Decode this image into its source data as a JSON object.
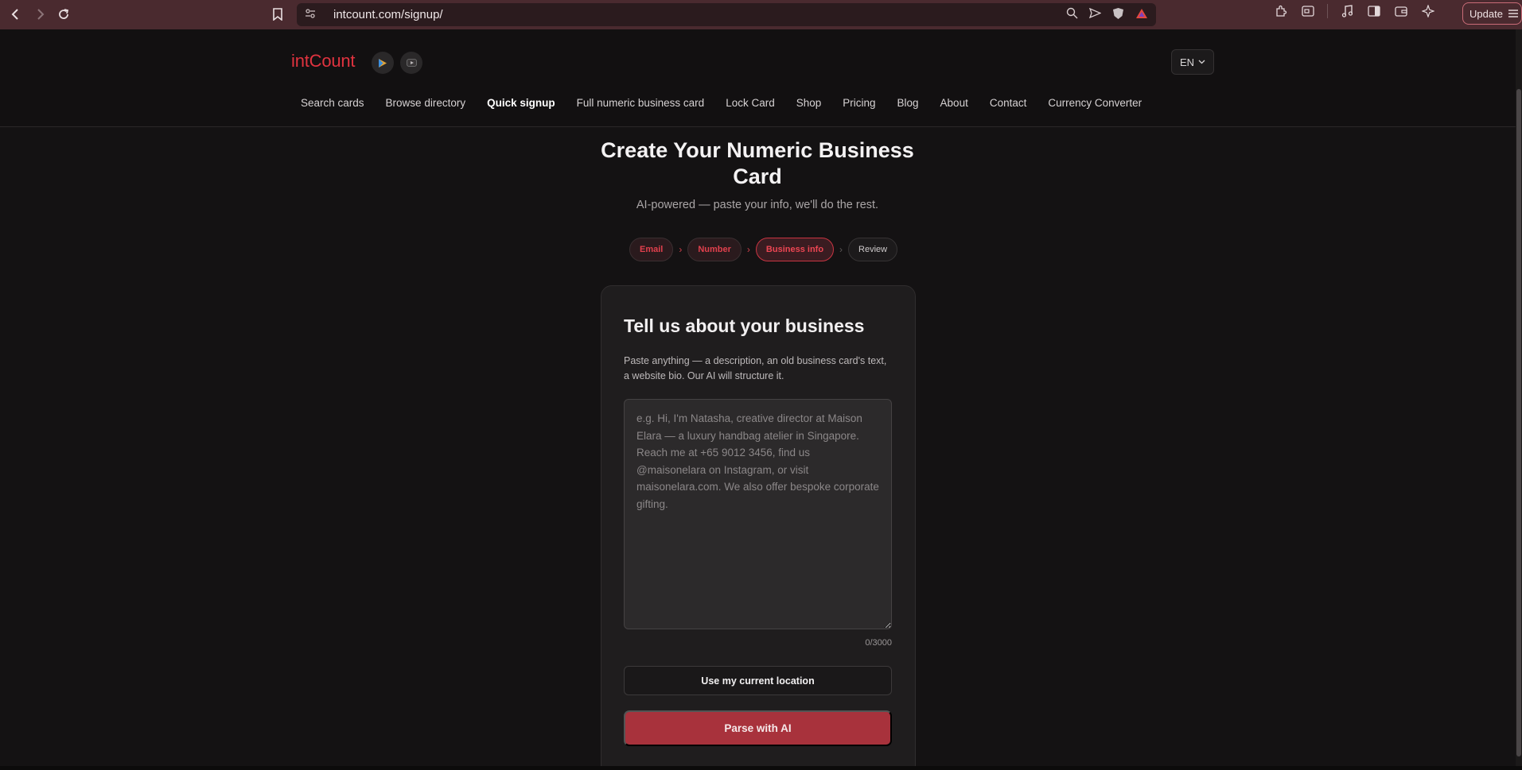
{
  "browser": {
    "url": "intcount.com/signup/",
    "update_label": "Update"
  },
  "header": {
    "logo": "intCount",
    "language": "EN",
    "nav": [
      {
        "label": "Search cards"
      },
      {
        "label": "Browse directory"
      },
      {
        "label": "Quick signup",
        "active": true
      },
      {
        "label": "Full numeric business card"
      },
      {
        "label": "Lock Card"
      },
      {
        "label": "Shop"
      },
      {
        "label": "Pricing"
      },
      {
        "label": "Blog"
      },
      {
        "label": "About"
      },
      {
        "label": "Contact"
      },
      {
        "label": "Currency Converter"
      }
    ]
  },
  "hero": {
    "title": "Create Your Numeric Business Card",
    "subtitle": "AI-powered — paste your info, we'll do the rest."
  },
  "steps": [
    {
      "label": "Email",
      "state": "done"
    },
    {
      "label": "Number",
      "state": "done"
    },
    {
      "label": "Business info",
      "state": "current"
    },
    {
      "label": "Review",
      "state": "pending"
    }
  ],
  "card": {
    "title": "Tell us about your business",
    "description": "Paste anything — a description, an old business card's text, a website bio. Our AI will structure it.",
    "textarea": {
      "value": "",
      "placeholder": "e.g. Hi, I'm Natasha, creative director at Maison Elara — a luxury handbag atelier in Singapore. Reach me at +65 9012 3456, find us @maisonelara on Instagram, or visit maisonelara.com. We also offer bespoke corporate gifting."
    },
    "counter": "0/3000",
    "location_button": "Use my current location",
    "parse_button": "Parse with AI"
  },
  "colors": {
    "accent": "#e0333f",
    "primary_button": "#a8323c",
    "chrome_bar": "#4a2a2f",
    "page_background": "#141213"
  }
}
